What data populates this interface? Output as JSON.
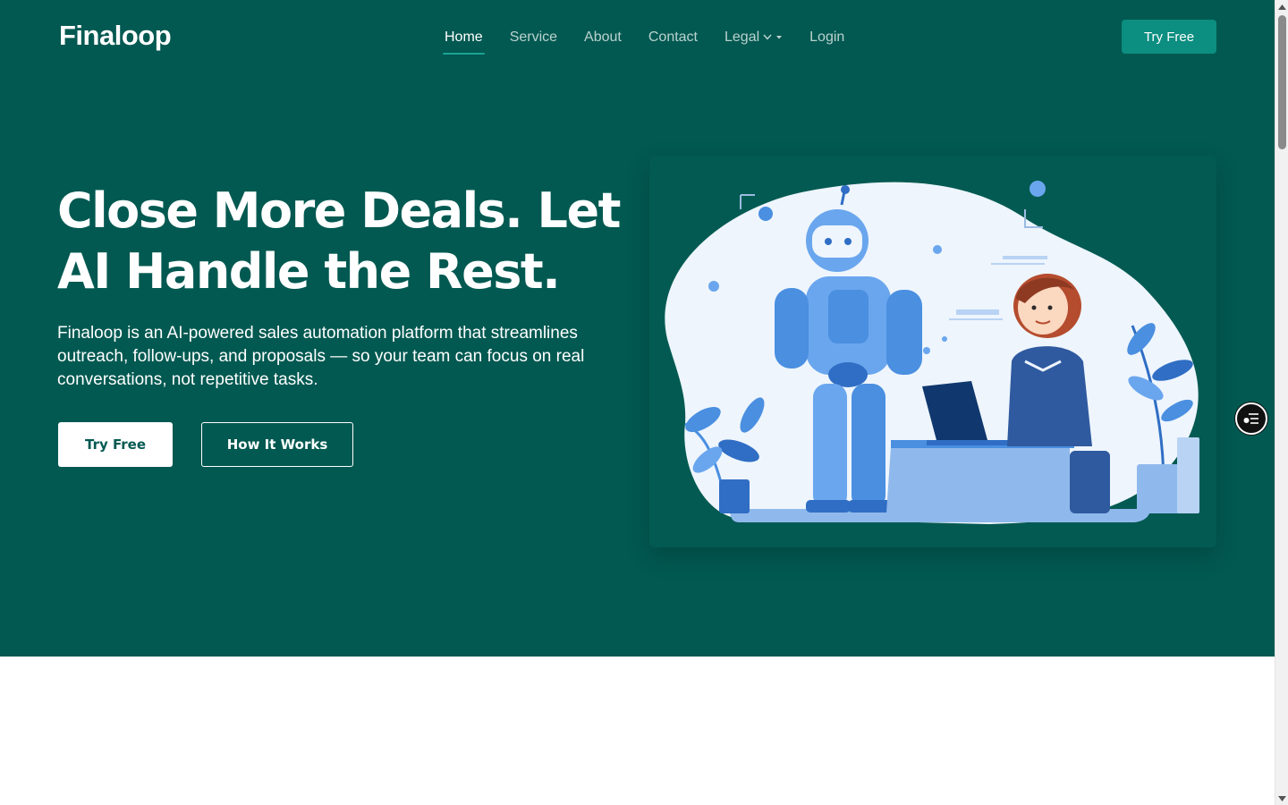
{
  "header": {
    "logo_text": "Finaloop",
    "nav": [
      {
        "label": "Home",
        "active": true
      },
      {
        "label": "Service",
        "active": false
      },
      {
        "label": "About",
        "active": false
      },
      {
        "label": "Contact",
        "active": false
      },
      {
        "label": "Legal",
        "active": false,
        "has_dropdown": true
      },
      {
        "label": "Login",
        "active": false
      }
    ],
    "cta_label": "Try Free"
  },
  "hero": {
    "headline_line1": "Close More Deals. Let",
    "headline_line2": "AI Handle the Rest.",
    "description": "Finaloop is an AI-powered sales automation platform that streamlines outreach, follow-ups, and proposals — so your team can focus on real conversations, not repetitive tasks.",
    "primary_button": "Try Free",
    "secondary_button": "How It Works",
    "illustration": "robot-and-woman-at-laptop"
  },
  "colors": {
    "hero_background": "#025951",
    "accent": "#0c8e80",
    "active_underline": "#1aa394",
    "illustration_blue": "#4a8fe0"
  },
  "widgets": {
    "accessibility_icon": "accessibility-menu-icon"
  }
}
